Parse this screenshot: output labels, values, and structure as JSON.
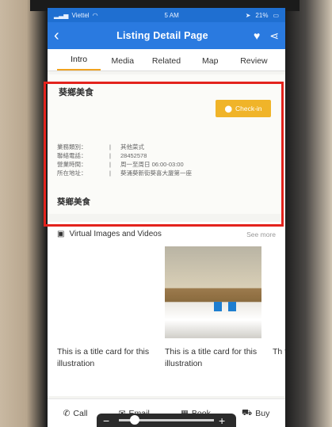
{
  "status_bar": {
    "carrier": "Viettel",
    "time": "5 AM",
    "battery": "21%"
  },
  "app_bar": {
    "title": "Listing Detail Page"
  },
  "tabs": [
    {
      "label": "Intro",
      "active": true
    },
    {
      "label": "Media",
      "active": false
    },
    {
      "label": "Related",
      "active": false
    },
    {
      "label": "Map",
      "active": false
    },
    {
      "label": "Review",
      "active": false
    }
  ],
  "detail": {
    "shop_name": "葵鄉美食",
    "checkin_label": "Check-in",
    "info": [
      {
        "key": "業務類別：",
        "value": "其他菜式"
      },
      {
        "key": "聯絡電話：",
        "value": "28452578"
      },
      {
        "key": "營業時間：",
        "value": "周一至周日 06:00-03:00"
      },
      {
        "key": "所在地址：",
        "value": "葵涌葵新街葵喜大廈第一座"
      }
    ],
    "footer_name": "葵鄉美食"
  },
  "gallery": {
    "title": "Virtual Images and Videos",
    "see_more": "See more",
    "cards": [
      {
        "caption": "This is a title card for this illustration"
      },
      {
        "caption": "This is a title card for this illustration"
      },
      {
        "caption": "Th thi"
      }
    ]
  },
  "bottom_bar": [
    {
      "label": "Call",
      "icon": "phone-icon"
    },
    {
      "label": "Email",
      "icon": "email-icon"
    },
    {
      "label": "Book",
      "icon": "calendar-icon"
    },
    {
      "label": "Buy",
      "icon": "cart-icon"
    }
  ],
  "colors": {
    "primary": "#2a7ae0",
    "accent": "#f0a320",
    "highlight": "#e3231d"
  }
}
